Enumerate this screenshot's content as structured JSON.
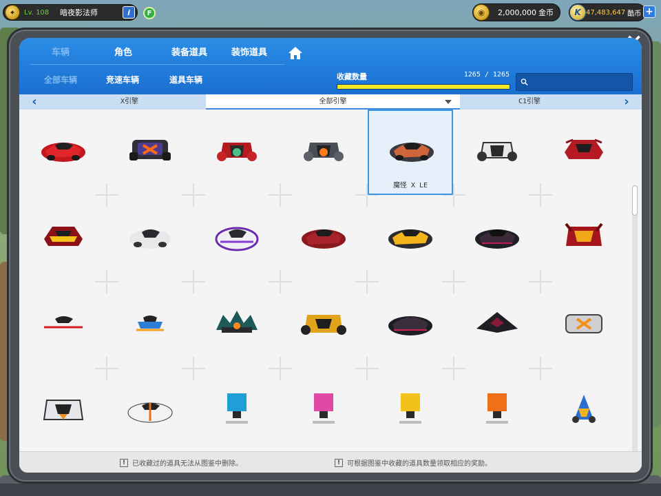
{
  "hud": {
    "level": "Lv. 108",
    "player_name": "暗夜影法师",
    "info_icon": "i",
    "f_icon": "F",
    "gold_value": "2,000,000",
    "gold_unit": "金币",
    "k_value": "47,483,647",
    "k_unit": "酷币",
    "plus_icon": "+",
    "coin_icon": "coin-icon",
    "k_coin_icon": "k-coin-icon"
  },
  "close_icon": "×",
  "tabs_main": [
    {
      "label": "车辆",
      "active": true
    },
    {
      "label": "角色",
      "active": false
    },
    {
      "label": "装备道具",
      "active": false
    },
    {
      "label": "装饰道具",
      "active": false
    }
  ],
  "tabs_sub": [
    {
      "label": "全部车辆",
      "active": true
    },
    {
      "label": "竞速车辆",
      "active": false
    },
    {
      "label": "道具车辆",
      "active": false
    }
  ],
  "collection": {
    "label": "收藏数量",
    "count_text": "1265  / 1265",
    "collected": 1265,
    "total": 1265
  },
  "search": {
    "placeholder": "",
    "value": ""
  },
  "filter": {
    "prev": "X引擎",
    "current": "全部引擎",
    "next": "C1引擎"
  },
  "selected_item": {
    "label": "魔怪 X LE"
  },
  "footer": {
    "note1": "已收藏过的道具无法从图鉴中删除。",
    "note2": "可根据图鉴中收藏的道具数量领取相应的奖励。"
  },
  "colors": {
    "header_blue": "#1a6fd1",
    "progress_fill": "#f5e623",
    "selection_border": "#3a96e6"
  }
}
